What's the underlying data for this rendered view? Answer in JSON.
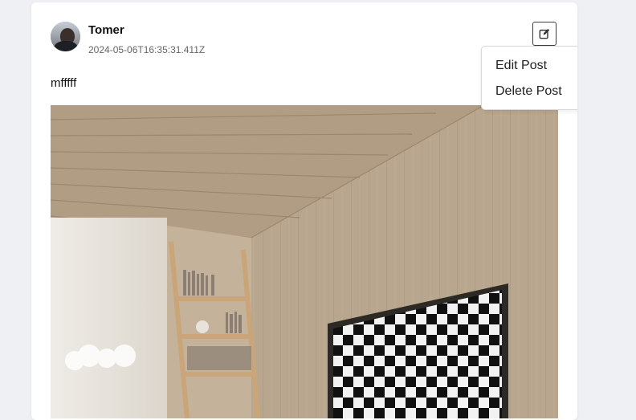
{
  "post": {
    "author": "Tomer",
    "timestamp": "2024-05-06T16:35:31.411Z",
    "text": "mfffff",
    "avatar_icon": "user-avatar",
    "edit_icon": "edit-icon"
  },
  "menu": {
    "items": [
      {
        "label": "Edit Post"
      },
      {
        "label": "Delete Post"
      }
    ]
  },
  "colors": {
    "page_background": "#eef0f4",
    "card_background": "#ffffff",
    "wood": "#b8a48a"
  }
}
